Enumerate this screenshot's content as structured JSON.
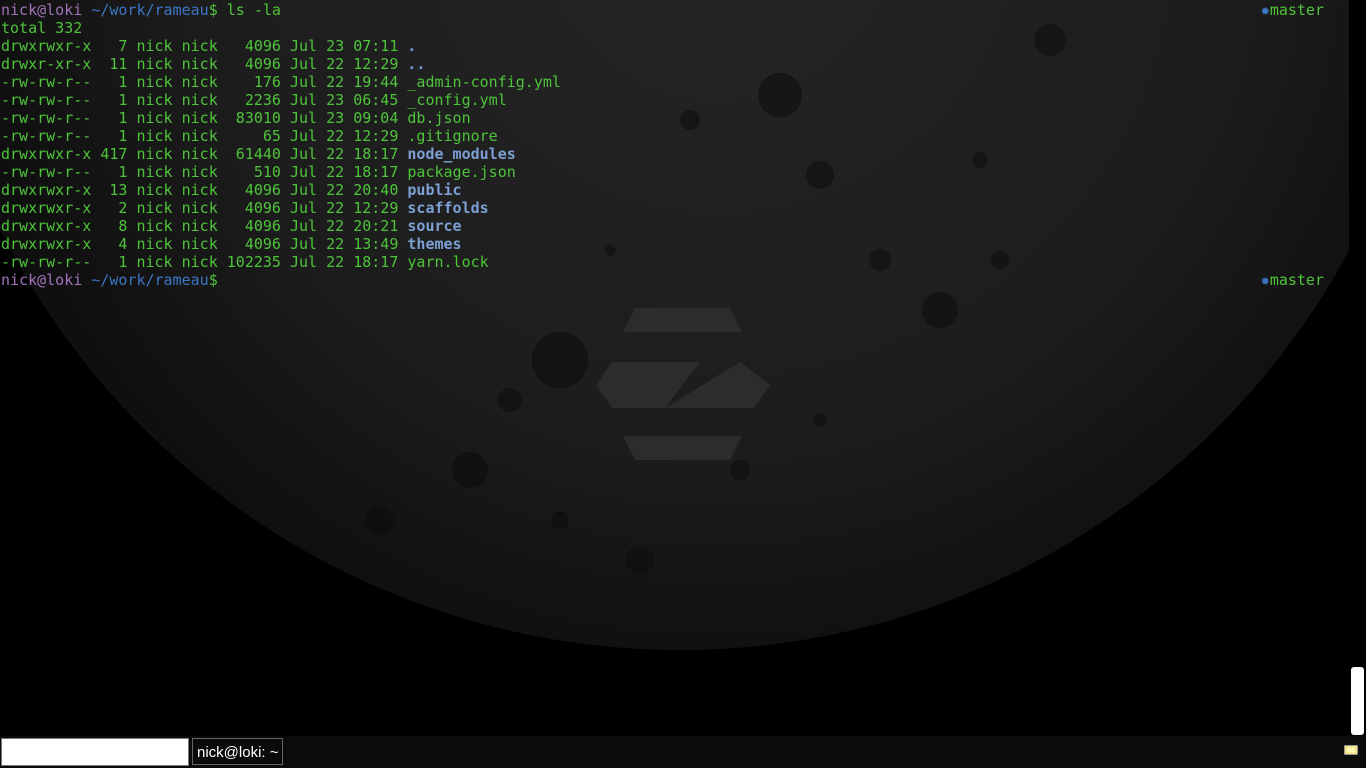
{
  "terminal": {
    "prompt": {
      "user_host": "nick@loki",
      "path": "~/work/rameau",
      "symbol": "$"
    },
    "command": "ls -la",
    "git_branch": "master",
    "git_marker": "✹",
    "total_line": "total 332",
    "entries": [
      {
        "meta": "drwxrwxr-x   7 nick nick   4096 Jul 23 07:11 ",
        "name": ".",
        "kind": "dot"
      },
      {
        "meta": "drwxr-xr-x  11 nick nick   4096 Jul 22 12:29 ",
        "name": "..",
        "kind": "dot"
      },
      {
        "meta": "-rw-rw-r--   1 nick nick    176 Jul 22 19:44 ",
        "name": "_admin-config.yml",
        "kind": "file"
      },
      {
        "meta": "-rw-rw-r--   1 nick nick   2236 Jul 23 06:45 ",
        "name": "_config.yml",
        "kind": "file"
      },
      {
        "meta": "-rw-rw-r--   1 nick nick  83010 Jul 23 09:04 ",
        "name": "db.json",
        "kind": "file"
      },
      {
        "meta": "-rw-rw-r--   1 nick nick     65 Jul 22 12:29 ",
        "name": ".gitignore",
        "kind": "file"
      },
      {
        "meta": "drwxrwxr-x 417 nick nick  61440 Jul 22 18:17 ",
        "name": "node_modules",
        "kind": "dir"
      },
      {
        "meta": "-rw-rw-r--   1 nick nick    510 Jul 22 18:17 ",
        "name": "package.json",
        "kind": "file"
      },
      {
        "meta": "drwxrwxr-x  13 nick nick   4096 Jul 22 20:40 ",
        "name": "public",
        "kind": "dir"
      },
      {
        "meta": "drwxrwxr-x   2 nick nick   4096 Jul 22 12:29 ",
        "name": "scaffolds",
        "kind": "dir"
      },
      {
        "meta": "drwxrwxr-x   8 nick nick   4096 Jul 22 20:21 ",
        "name": "source",
        "kind": "dir"
      },
      {
        "meta": "drwxrwxr-x   4 nick nick   4096 Jul 22 13:49 ",
        "name": "themes",
        "kind": "dir"
      },
      {
        "meta": "-rw-rw-r--   1 nick nick 102235 Jul 22 18:17 ",
        "name": "yarn.lock",
        "kind": "file"
      }
    ]
  },
  "taskbar": {
    "run_input_value": "",
    "window_button_label": "nick@loki: ~",
    "tray_icon": "notification-icon"
  },
  "colors": {
    "background": "#000000",
    "prompt_user": "#a072b8",
    "prompt_path": "#3c75c4",
    "text_green": "#4ec43a",
    "directory_blue": "#7d9fd4"
  }
}
